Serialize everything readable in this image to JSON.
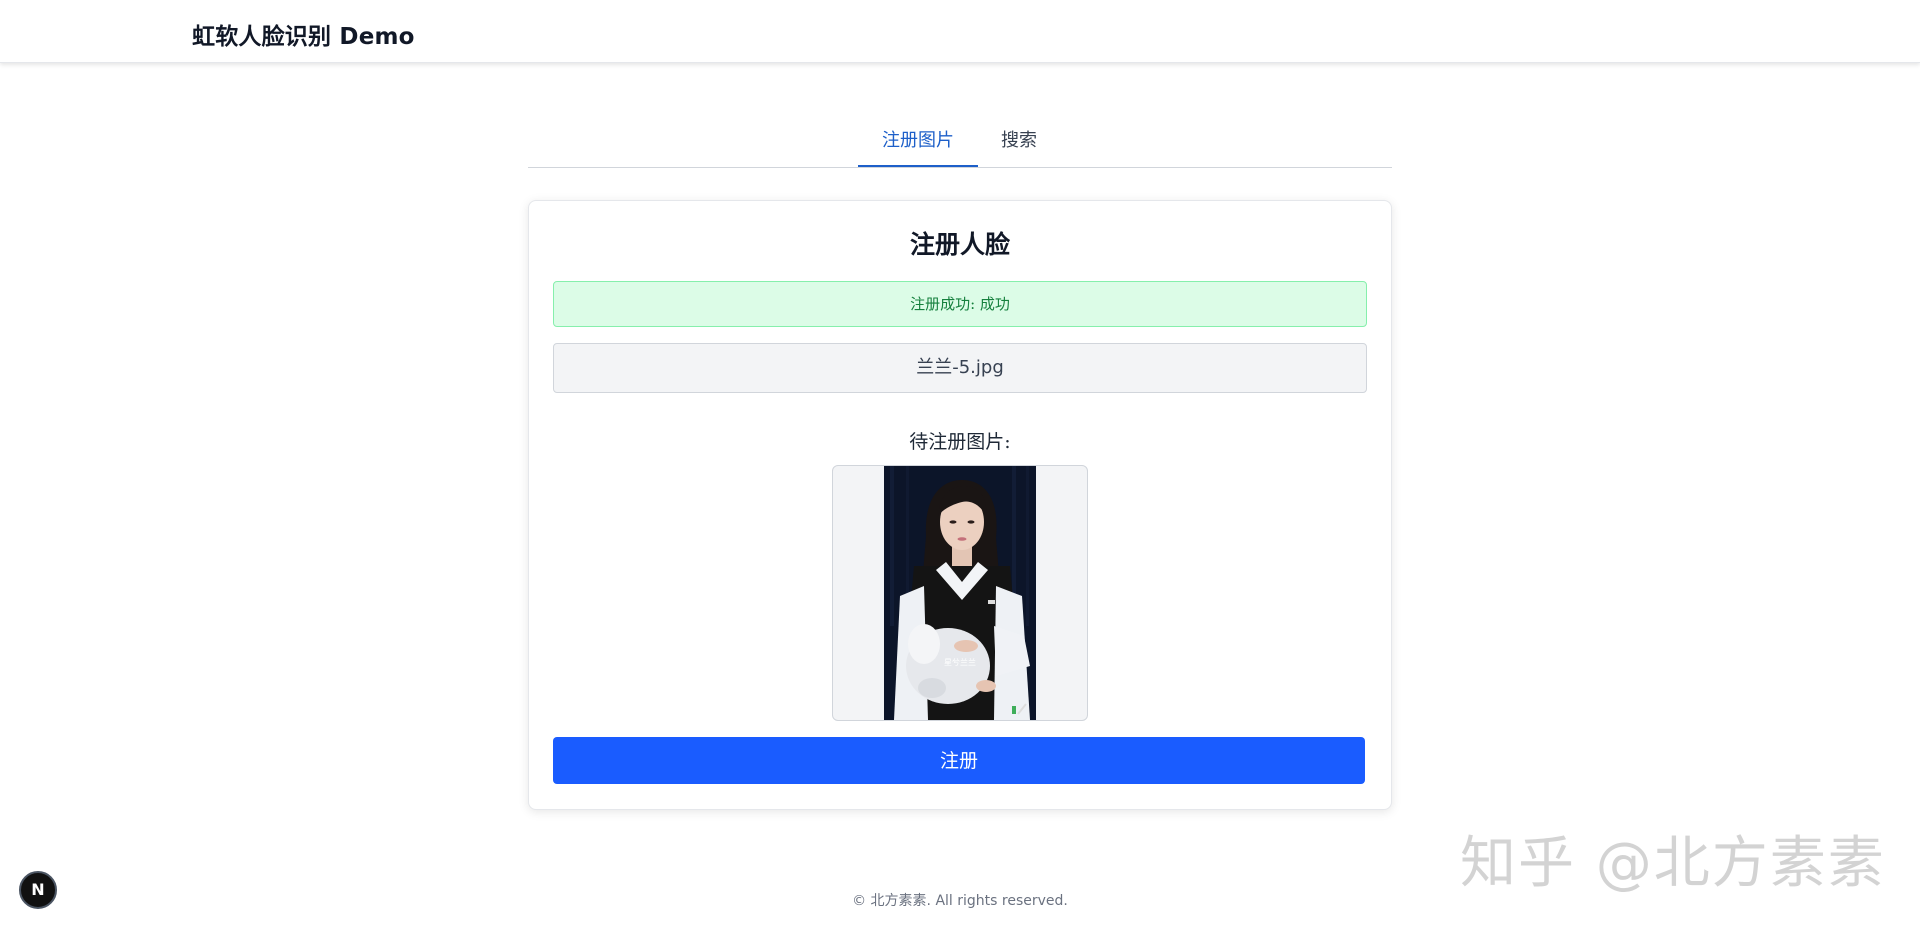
{
  "header": {
    "title": "虹软人脸识别 Demo"
  },
  "tabs": [
    {
      "label": "注册图片",
      "active": true
    },
    {
      "label": "搜索",
      "active": false
    }
  ],
  "card": {
    "title": "注册人脸",
    "alert_text": "注册成功: 成功",
    "file_name": "兰兰-5.jpg",
    "preview_label": "待注册图片:",
    "photo_caption": "星兮兰兰",
    "register_button": "注册"
  },
  "watermark": "知乎 @北方素素",
  "footer": "© 北方素素. All rights reserved.",
  "dev_badge": "N",
  "colors": {
    "accent": "#1a5cff",
    "tab_active": "#1d5fc9",
    "alert_bg": "#dcfce7",
    "alert_text": "#15803d"
  }
}
